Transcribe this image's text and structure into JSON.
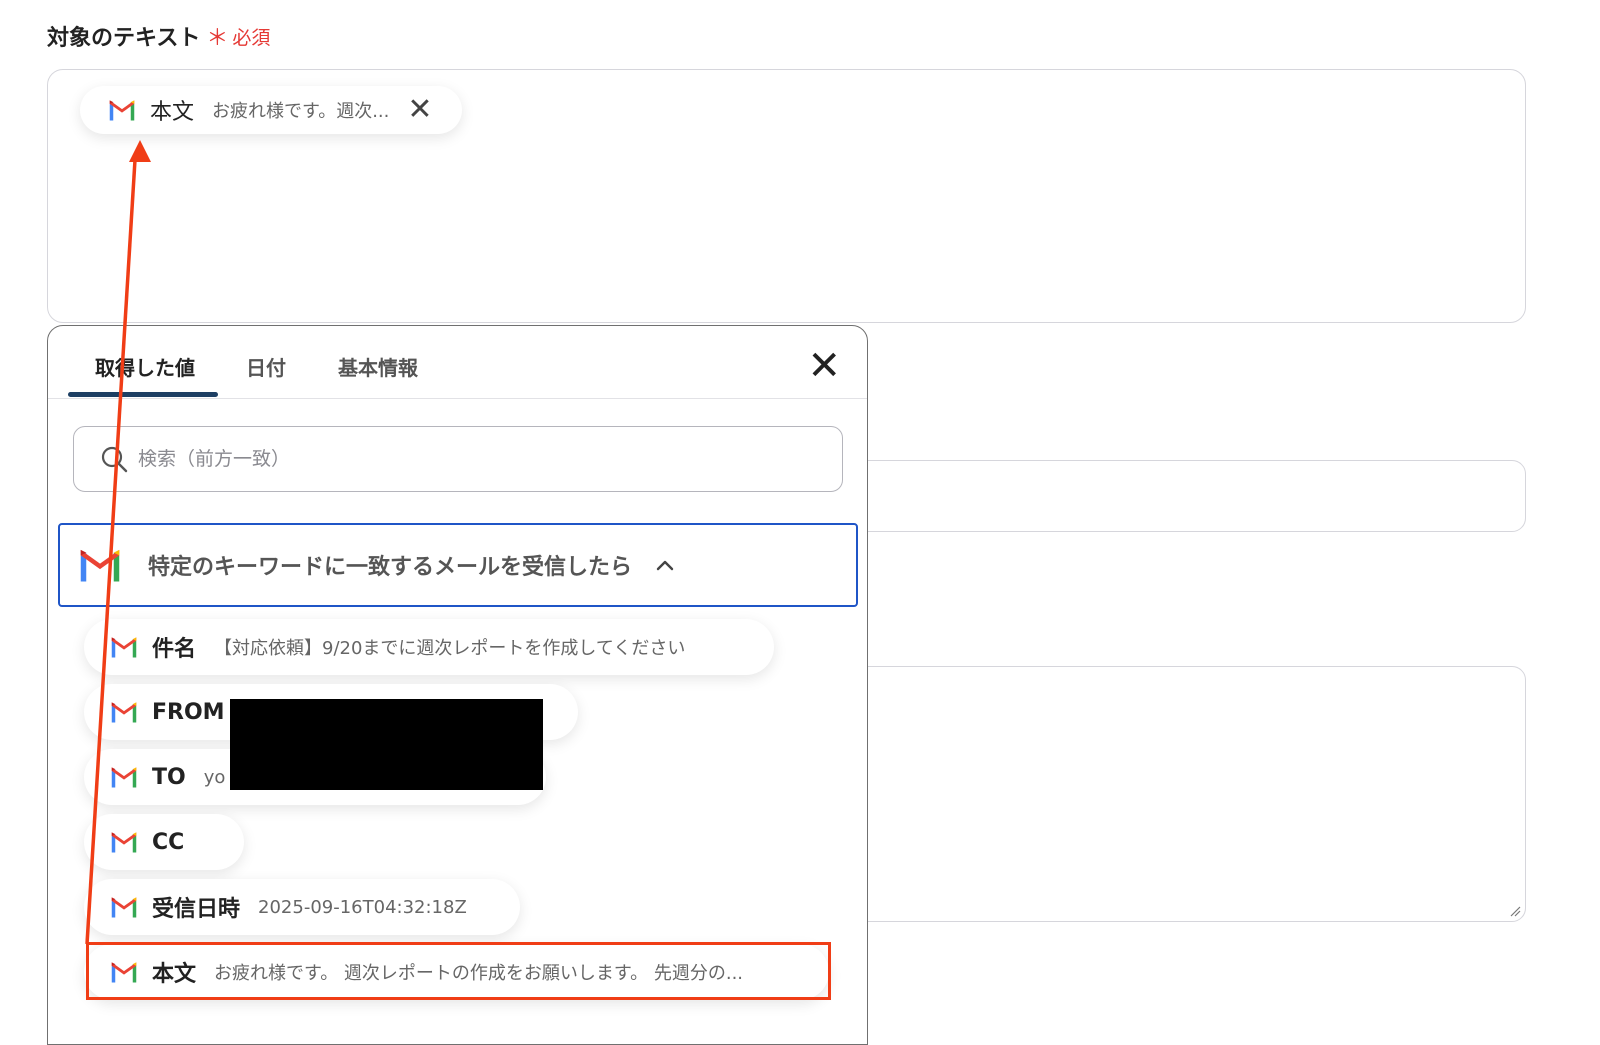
{
  "field": {
    "label": "対象のテキスト",
    "required_mark": "＊",
    "required_text": "必須",
    "selected_chip": {
      "name": "本文",
      "value": "お疲れ様です。週次..."
    }
  },
  "icons": {
    "gmail": "gmail-logo-icon",
    "close": "close-icon",
    "search": "search-icon",
    "chevron": "chevron-up-icon"
  },
  "colors": {
    "required": "#e53935",
    "active_tab_underline": "#1d3f63",
    "group_border": "#1f55c7",
    "highlight": "#f03d16"
  },
  "panel": {
    "tabs": [
      {
        "label": "取得した値",
        "active": true
      },
      {
        "label": "日付",
        "active": false
      },
      {
        "label": "基本情報",
        "active": false
      }
    ],
    "search": {
      "placeholder": "検索（前方一致）",
      "value": ""
    },
    "group": {
      "title": "特定のキーワードに一致するメールを受信したら"
    },
    "items": [
      {
        "name": "件名",
        "value": "【対応依頼】9/20までに週次レポートを作成してください"
      },
      {
        "name": "FROM",
        "value": ""
      },
      {
        "name": "TO",
        "value": "yo"
      },
      {
        "name": "CC",
        "value": ""
      },
      {
        "name": "受信日時",
        "value": "2025-09-16T04:32:18Z"
      },
      {
        "name": "本文",
        "value": "お疲れ様です。 週次レポートの作成をお願いします。 先週分の..."
      }
    ]
  }
}
